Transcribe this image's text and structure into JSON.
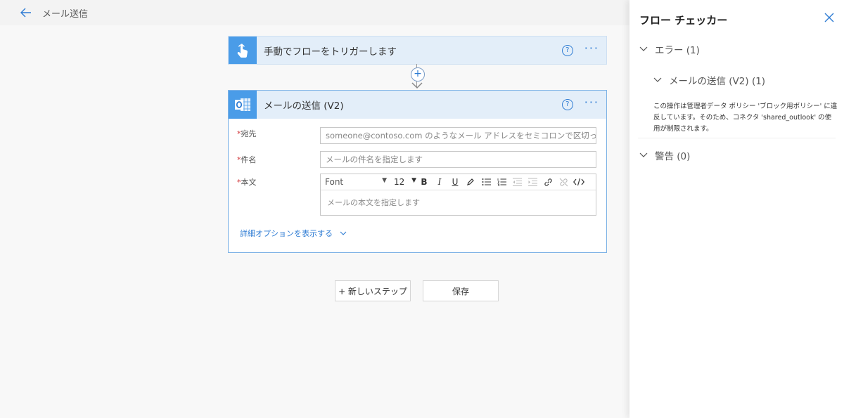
{
  "header": {
    "title": "メール送信"
  },
  "trigger": {
    "title": "手動でフローをトリガーします"
  },
  "action": {
    "title": "メールの送信 (V2)",
    "fields": {
      "to_label": "宛先",
      "to_placeholder": "someone@contoso.com のようなメール アドレスをセミコロンで区切って指定し",
      "subject_label": "件名",
      "subject_placeholder": "メールの件名を指定します",
      "body_label": "本文",
      "body_placeholder": "メールの本文を指定します"
    },
    "editor": {
      "font": "Font",
      "size": "12"
    },
    "advanced_link": "詳細オプションを表示する"
  },
  "buttons": {
    "new_step": "+ 新しいステップ",
    "save": "保存"
  },
  "checker": {
    "title": "フロー チェッカー",
    "errors_label": "エラー (1)",
    "error_item_label": "メールの送信 (V2) (1)",
    "error_message": "この操作は管理者データ ポリシー 'ブロック用ポリシー' に違反しています。そのため、コネクタ 'shared_outlook' の使用が制限されます。",
    "warnings_label": "警告 (0)"
  },
  "colors": {
    "accent": "#2d7bd3",
    "header_bg": "#e3eef9",
    "icon_bg": "#4a9ce8",
    "required": "#d13438"
  },
  "icons": [
    "back-arrow-icon",
    "touch-icon",
    "help-icon",
    "more-icon",
    "add-icon",
    "outlook-icon",
    "close-icon",
    "chevron-down-icon"
  ]
}
